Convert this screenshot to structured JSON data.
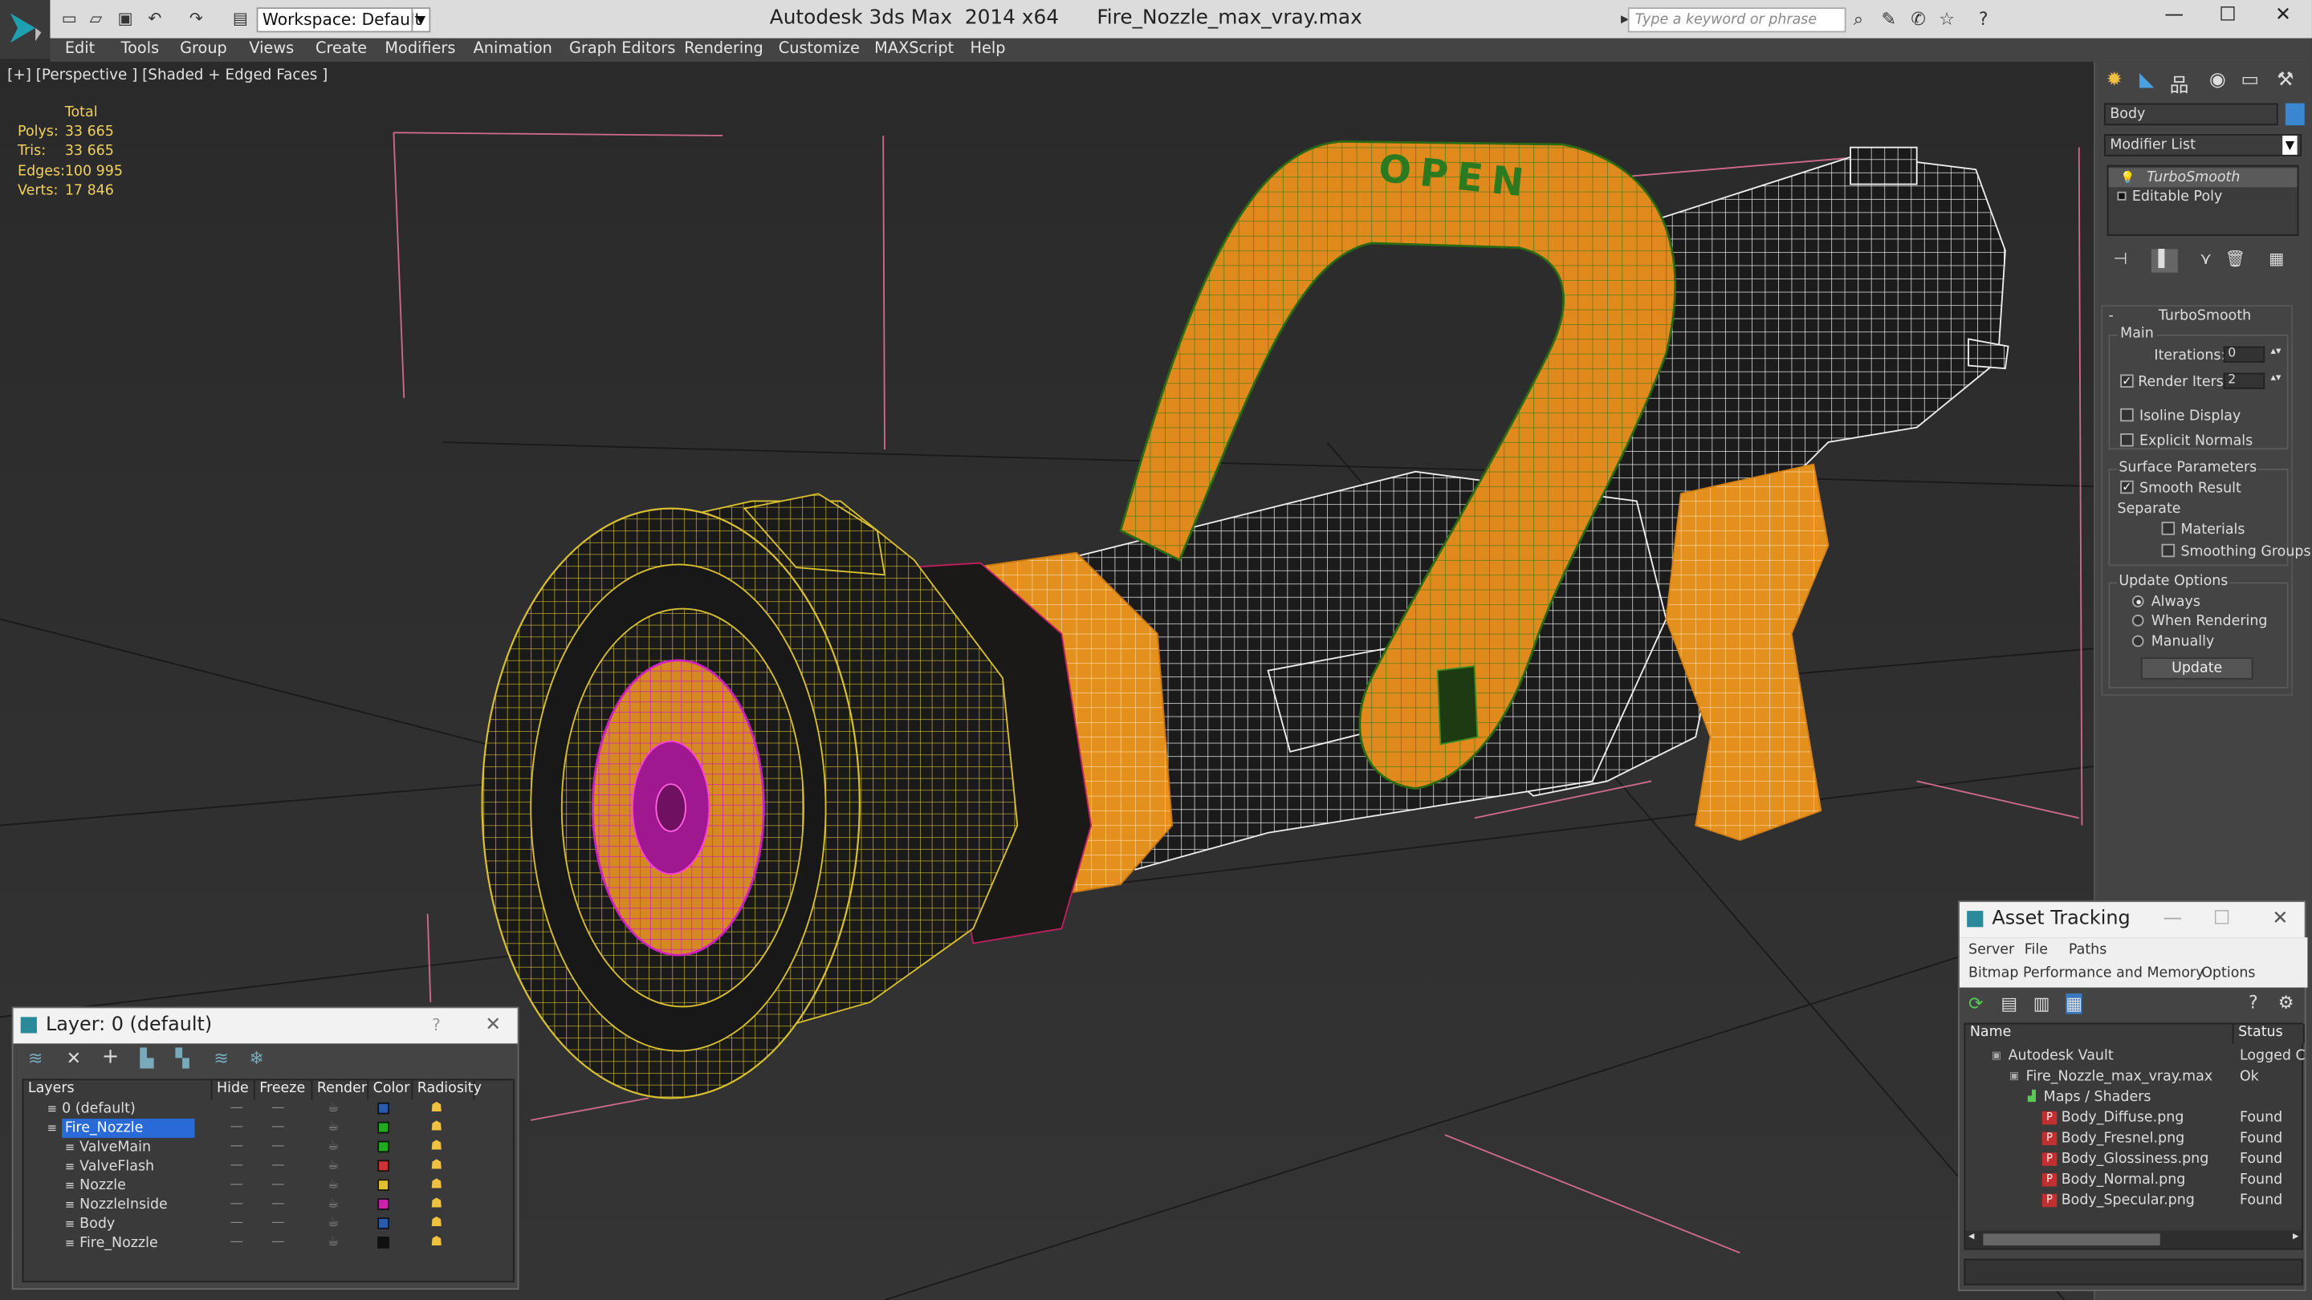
{
  "app": {
    "title": "Autodesk 3ds Max  2014 x64      Fire_Nozzle_max_vray.max",
    "workspace": "Workspace: Default",
    "search_placeholder": "Type a keyword or phrase"
  },
  "menu": [
    "Edit",
    "Tools",
    "Group",
    "Views",
    "Create",
    "Modifiers",
    "Animation",
    "Graph Editors",
    "Rendering",
    "Customize",
    "MAXScript",
    "Help"
  ],
  "viewport": {
    "label": "[+] [Perspective ] [Shaded + Edged Faces ]",
    "stats_header": "Total",
    "stats": [
      {
        "k": "Polys:",
        "v": "33 665"
      },
      {
        "k": "Tris:",
        "v": "33 665"
      },
      {
        "k": "Edges:",
        "v": "100 995"
      },
      {
        "k": "Verts:",
        "v": "17 846"
      }
    ]
  },
  "command_panel": {
    "object_name": "Body",
    "modifier_list": "Modifier List",
    "stack": [
      "TurboSmooth",
      "Editable Poly"
    ],
    "rollout_title": "TurboSmooth",
    "main_label": "Main",
    "iterations_label": "Iterations:",
    "iterations_value": "0",
    "render_iters_label": "Render Iters:",
    "render_iters_value": "2",
    "isoline": "Isoline Display",
    "explicit": "Explicit Normals",
    "surface_params": "Surface Parameters",
    "smooth_result": "Smooth Result",
    "separate": "Separate",
    "materials": "Materials",
    "smoothing_groups": "Smoothing Groups",
    "update_options": "Update Options",
    "always": "Always",
    "when_rendering": "When Rendering",
    "manually": "Manually",
    "update_btn": "Update"
  },
  "layer_dialog": {
    "title": "Layer: 0 (default)",
    "headers": [
      "Layers",
      "Hide",
      "Freeze",
      "Render",
      "Color",
      "Radiosity"
    ],
    "rows": [
      {
        "name": "0 (default)",
        "color": "#2a5aaa",
        "indent": 1
      },
      {
        "name": "Fire_Nozzle",
        "color": "#22aa22",
        "indent": 1,
        "selected": true
      },
      {
        "name": "ValveMain",
        "color": "#22aa22",
        "indent": 2
      },
      {
        "name": "ValveFlash",
        "color": "#cc3333",
        "indent": 2
      },
      {
        "name": "Nozzle",
        "color": "#e0c030",
        "indent": 2
      },
      {
        "name": "NozzleInside",
        "color": "#cc22aa",
        "indent": 2
      },
      {
        "name": "Body",
        "color": "#2a5aaa",
        "indent": 2
      },
      {
        "name": "Fire_Nozzle",
        "color": "#111111",
        "indent": 2
      }
    ]
  },
  "asset_dialog": {
    "title": "Asset Tracking",
    "menu1": [
      "Server",
      "File",
      "Paths"
    ],
    "menu2": [
      "Bitmap Performance and Memory",
      "Options"
    ],
    "headers": [
      "Name",
      "Status"
    ],
    "rows": [
      {
        "name": "Autodesk Vault",
        "status": "Logged C",
        "indent": 0
      },
      {
        "name": "Fire_Nozzle_max_vray.max",
        "status": "Ok",
        "indent": 1
      },
      {
        "name": "Maps / Shaders",
        "status": "",
        "indent": 2
      },
      {
        "name": "Body_Diffuse.png",
        "status": "Found",
        "indent": 3
      },
      {
        "name": "Body_Fresnel.png",
        "status": "Found",
        "indent": 3
      },
      {
        "name": "Body_Glossiness.png",
        "status": "Found",
        "indent": 3
      },
      {
        "name": "Body_Normal.png",
        "status": "Found",
        "indent": 3
      },
      {
        "name": "Body_Specular.png",
        "status": "Found",
        "indent": 3
      }
    ]
  },
  "model": {
    "handle_text": "OPEN"
  }
}
